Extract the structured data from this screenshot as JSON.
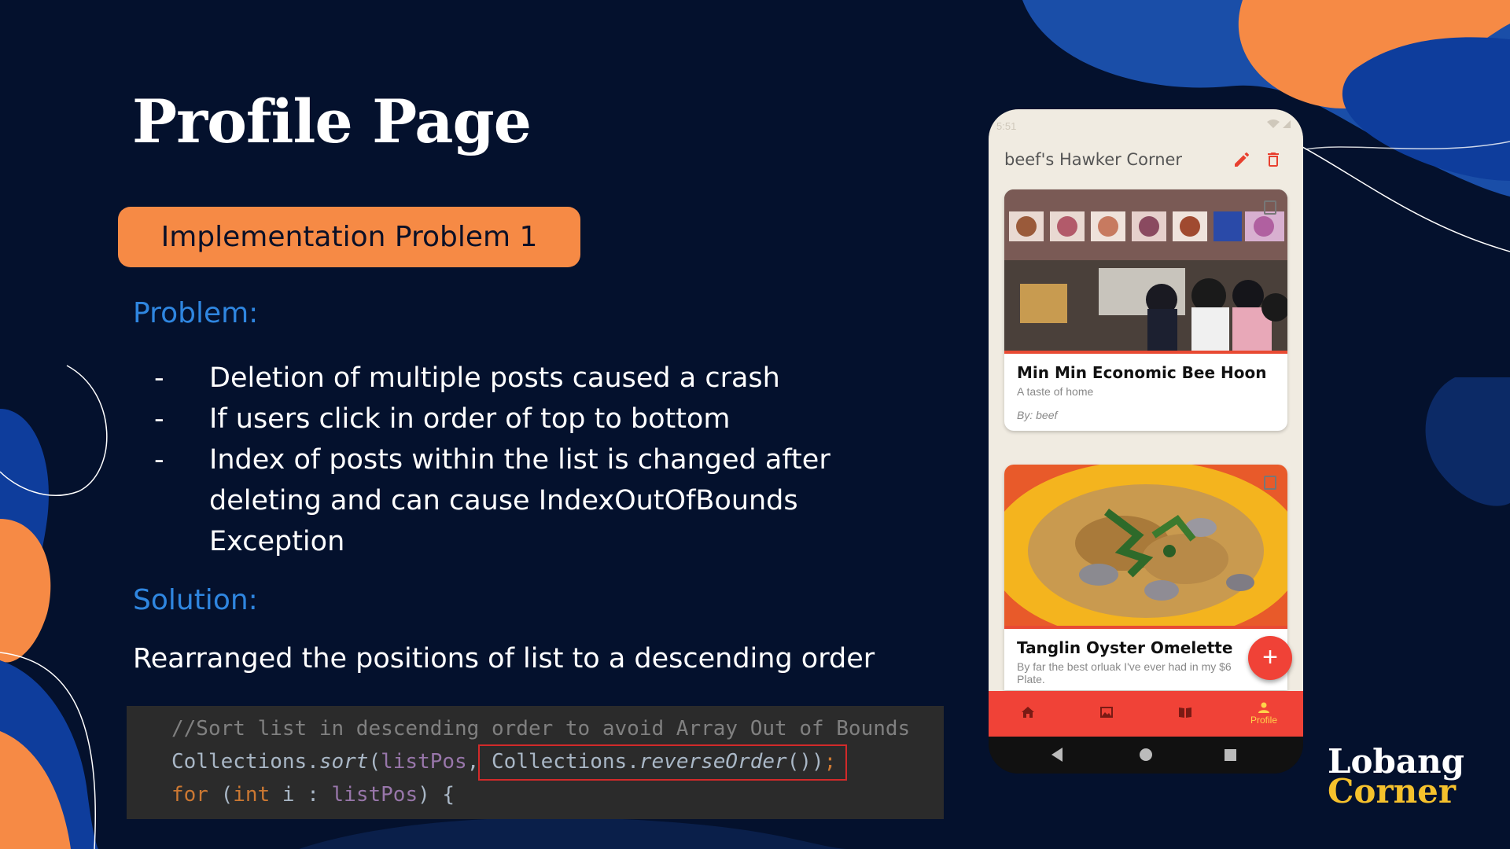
{
  "slide": {
    "title": "Profile Page",
    "pill_label": "Implementation Problem 1",
    "problem_label": "Problem:",
    "problems": [
      "Deletion of multiple posts caused a crash",
      "If users click in order of top to bottom",
      "Index of posts within the list is changed after deleting and can cause IndexOutOfBounds Exception"
    ],
    "bullet_dash": "-",
    "solution_label": "Solution:",
    "solution_text": "Rearranged the positions of list to a descending order",
    "code": {
      "line1": "//Sort list in descending order to avoid Array Out of Bounds",
      "line2_a": "Collections.",
      "line2_fn": "sort",
      "line2_b": "(",
      "line2_var": "listPos",
      "line2_c": ", Collections.",
      "line2_fn2": "reverseOrder",
      "line2_d": "())",
      "line2_semi": ";",
      "line3_kw": "for",
      "line3_a": " (",
      "line3_kw2": "int",
      "line3_b": " i : ",
      "line3_var": "listPos",
      "line3_c": ") {"
    },
    "logo_line1": "Lobang",
    "logo_line2": "Corner"
  },
  "phone": {
    "status_time": "5:51",
    "appbar_title": "beef's Hawker Corner",
    "posts": [
      {
        "title": "Min Min Economic Bee Hoon",
        "subtitle": "A taste of home",
        "author": "By: beef"
      },
      {
        "title": "Tanglin Oyster Omelette",
        "subtitle": "By far the best orluak I've ever had in my $6 Plate."
      }
    ],
    "fab_label": "+",
    "nav": {
      "home": "",
      "gallery": "",
      "book": "",
      "profile": "Profile"
    },
    "colors": {
      "accent": "#f04237",
      "pill": "#f68a45",
      "background": "#04112d",
      "highlight": "#2f86e0"
    }
  }
}
